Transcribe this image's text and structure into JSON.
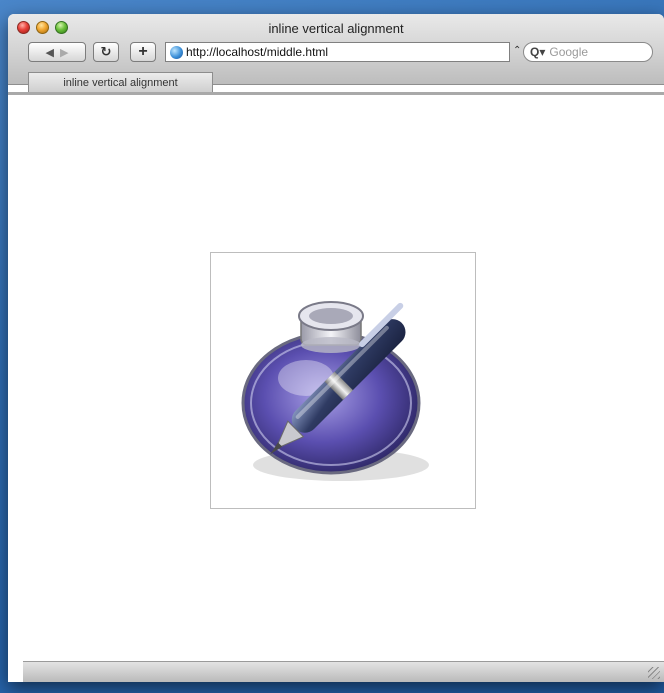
{
  "window": {
    "title": "inline vertical alignment"
  },
  "toolbar": {
    "back_icon": "back-arrow-icon",
    "forward_icon": "forward-arrow-icon",
    "reload_icon": "reload-icon",
    "add_icon": "add-bookmark-icon",
    "url": "http://localhost/middle.html",
    "search_placeholder": "Google"
  },
  "tabs": [
    {
      "label": "inline vertical alignment"
    }
  ],
  "content": {
    "image_icon": "textedit-inkwell-pen-icon"
  },
  "colors": {
    "desktop": "#2f6db3",
    "chrome_gray": "#d4d4d4",
    "ink_purple": "#5b4fb0",
    "pen_steel": "#3b4a73"
  }
}
